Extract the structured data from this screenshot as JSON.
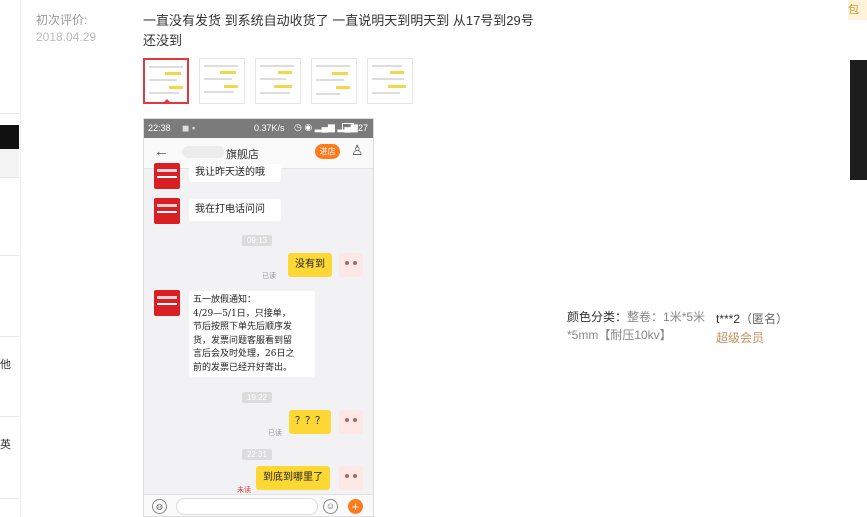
{
  "review": {
    "label": "初次评价:",
    "date": "2018.04.29",
    "text": "一直没有发货 到系统自动收货了 一直说明天到明天到 从17号到29号还没到"
  },
  "left_strip": {
    "chars": [
      "他",
      "英"
    ]
  },
  "phone": {
    "time": "22:38",
    "speed": "0.37K/s",
    "battery": "27",
    "back_icon": "arrow-left-icon",
    "store_name": "旗舰店",
    "enter_store": "进店",
    "messages": [
      {
        "side": "left",
        "text": "我让昨天送的哦"
      },
      {
        "side": "left",
        "text": "我在打电话问问"
      },
      {
        "type": "time",
        "text": "09:13"
      },
      {
        "side": "right",
        "text": "没有到",
        "status": "已读"
      },
      {
        "side": "left",
        "text": "五一放假通知：\n4/29—5/1日，只接单，\n节后按照下单先后顺序发\n货，发票问题客服看到留\n言后会及时处理，26日之\n前的发票已经开好寄出。"
      },
      {
        "type": "time",
        "text": "19:22"
      },
      {
        "side": "right",
        "text": "？？？",
        "status": "已读"
      },
      {
        "type": "time",
        "text": "22:31"
      },
      {
        "side": "right",
        "text": "到底到哪里了",
        "status": "未读"
      }
    ]
  },
  "spec": {
    "label": "颜色分类：",
    "value": "整卷：1米*5米*5mm【耐压10kv】"
  },
  "user": {
    "name": "t***2",
    "anon": "（匿名）",
    "level": "超级会员"
  },
  "right_tag": "包",
  "colors": {
    "selected_border": "#e4393c",
    "vip": "#c6935e",
    "bubble_yellow": "#fdd835",
    "store_red": "#d91f23",
    "enter_btn": "#ff7a1a"
  }
}
